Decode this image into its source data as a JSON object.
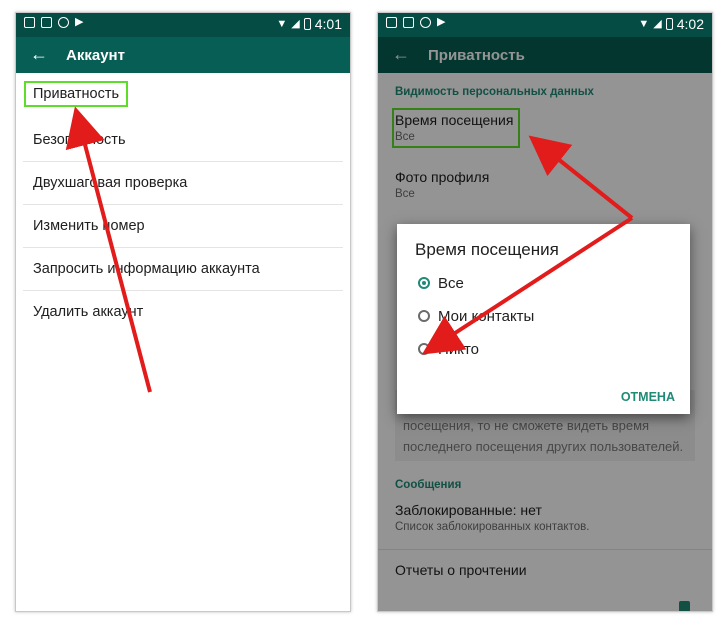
{
  "statusbar": {
    "left": {
      "time": "4:01"
    },
    "right": {
      "time": "4:02"
    }
  },
  "left": {
    "toolbar_title": "Аккаунт",
    "items": [
      "Приватность",
      "Безопасность",
      "Двухшаговая проверка",
      "Изменить номер",
      "Запросить информацию аккаунта",
      "Удалить аккаунт"
    ]
  },
  "right": {
    "toolbar_title": "Приватность",
    "section_personal": "Видимость персональных данных",
    "last_seen_title": "Время посещения",
    "last_seen_value": "Все",
    "photo_title": "Фото профиля",
    "photo_value": "Все",
    "note": "Если вы скроете время своего последнего посещения, то не сможете видеть время последнего посещения других пользователей.",
    "section_messages": "Сообщения",
    "blocked_title": "Заблокированные: нет",
    "blocked_sub": "Список заблокированных контактов.",
    "read_receipts": "Отчеты о прочтении"
  },
  "dialog": {
    "title": "Время посещения",
    "options": [
      "Все",
      "Мои контакты",
      "Никто"
    ],
    "selected": "Все",
    "cancel": "ОТМЕНА"
  },
  "colors": {
    "statusbar": "#054d44",
    "toolbar": "#075e54",
    "accent": "#1f8a76",
    "highlight": "#5edc2a",
    "arrow": "#e21b1b"
  }
}
